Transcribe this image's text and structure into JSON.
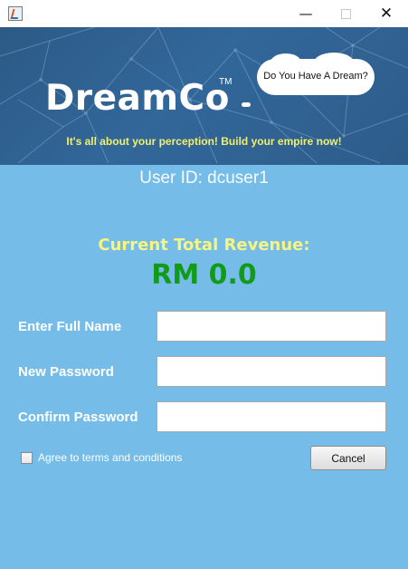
{
  "window": {
    "app_icon": "java-cup-icon",
    "controls": {
      "minimize": "—",
      "maximize": "□",
      "close": "✕"
    }
  },
  "banner": {
    "logo": "DreamCo",
    "trademark": "TM",
    "cloud_text": "Do You Have A Dream?",
    "tagline": "It's all about your perception! Build your empire now!"
  },
  "user": {
    "id_text": "User ID: dcuser1"
  },
  "revenue": {
    "label": "Current Total Revenue:",
    "value": "RM 0.0"
  },
  "form": {
    "full_name_label": "Enter Full Name",
    "full_name_value": "",
    "new_password_label": "New Password",
    "new_password_value": "",
    "confirm_password_label": "Confirm Password",
    "confirm_password_value": "",
    "agree_label": "Agree to terms and conditions",
    "agree_checked": false,
    "cancel_label": "Cancel"
  },
  "colors": {
    "banner": "#2d5d8c",
    "background": "#75bde8",
    "tagline": "#f2f06a",
    "revenue_label": "#f6f483",
    "revenue_value": "#129b19"
  }
}
